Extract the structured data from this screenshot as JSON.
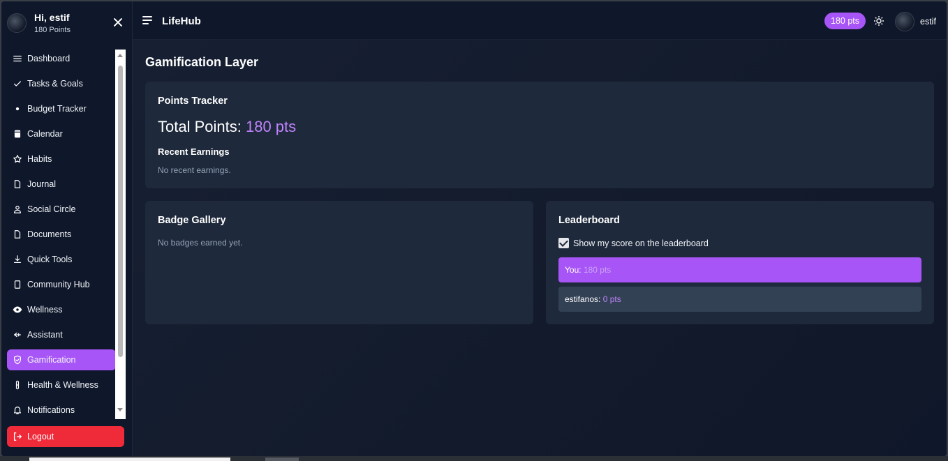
{
  "app": {
    "brand": "LifeHub",
    "points_pill": "180 pts",
    "username": "estif"
  },
  "sidebar": {
    "greeting": "Hi, estif",
    "points": "180 Points",
    "items": [
      {
        "label": "Dashboard",
        "icon": "menu-lines-icon"
      },
      {
        "label": "Tasks & Goals",
        "icon": "check-icon"
      },
      {
        "label": "Budget Tracker",
        "icon": "dot-icon"
      },
      {
        "label": "Calendar",
        "icon": "calendar-icon"
      },
      {
        "label": "Habits",
        "icon": "star-icon"
      },
      {
        "label": "Journal",
        "icon": "document-icon"
      },
      {
        "label": "Social Circle",
        "icon": "user-icon"
      },
      {
        "label": "Documents",
        "icon": "file-icon"
      },
      {
        "label": "Quick Tools",
        "icon": "download-icon"
      },
      {
        "label": "Community Hub",
        "icon": "page-icon"
      },
      {
        "label": "Wellness",
        "icon": "eye-icon"
      },
      {
        "label": "Assistant",
        "icon": "arrow-left-icon"
      },
      {
        "label": "Gamification",
        "icon": "shield-check-icon"
      },
      {
        "label": "Health & Wellness",
        "icon": "capsule-icon"
      },
      {
        "label": "Notifications",
        "icon": "bell-icon"
      }
    ],
    "active_index": 12,
    "logout": "Logout"
  },
  "main": {
    "title": "Gamification Layer",
    "points_tracker": {
      "title": "Points Tracker",
      "total_label": "Total Points:",
      "total_value": "180 pts",
      "recent_title": "Recent Earnings",
      "recent_empty": "No recent earnings."
    },
    "badges": {
      "title": "Badge Gallery",
      "empty": "No badges earned yet."
    },
    "leaderboard": {
      "title": "Leaderboard",
      "checkbox_label": "Show my score on the leaderboard",
      "checked": true,
      "rows": [
        {
          "name": "You:",
          "score": "180 pts"
        },
        {
          "name": "estifanos:",
          "score": "0 pts"
        }
      ]
    }
  },
  "colors": {
    "accent": "#a855f7",
    "background": "#0f172a",
    "card": "#1e293b",
    "logout": "#ef2b3a"
  }
}
